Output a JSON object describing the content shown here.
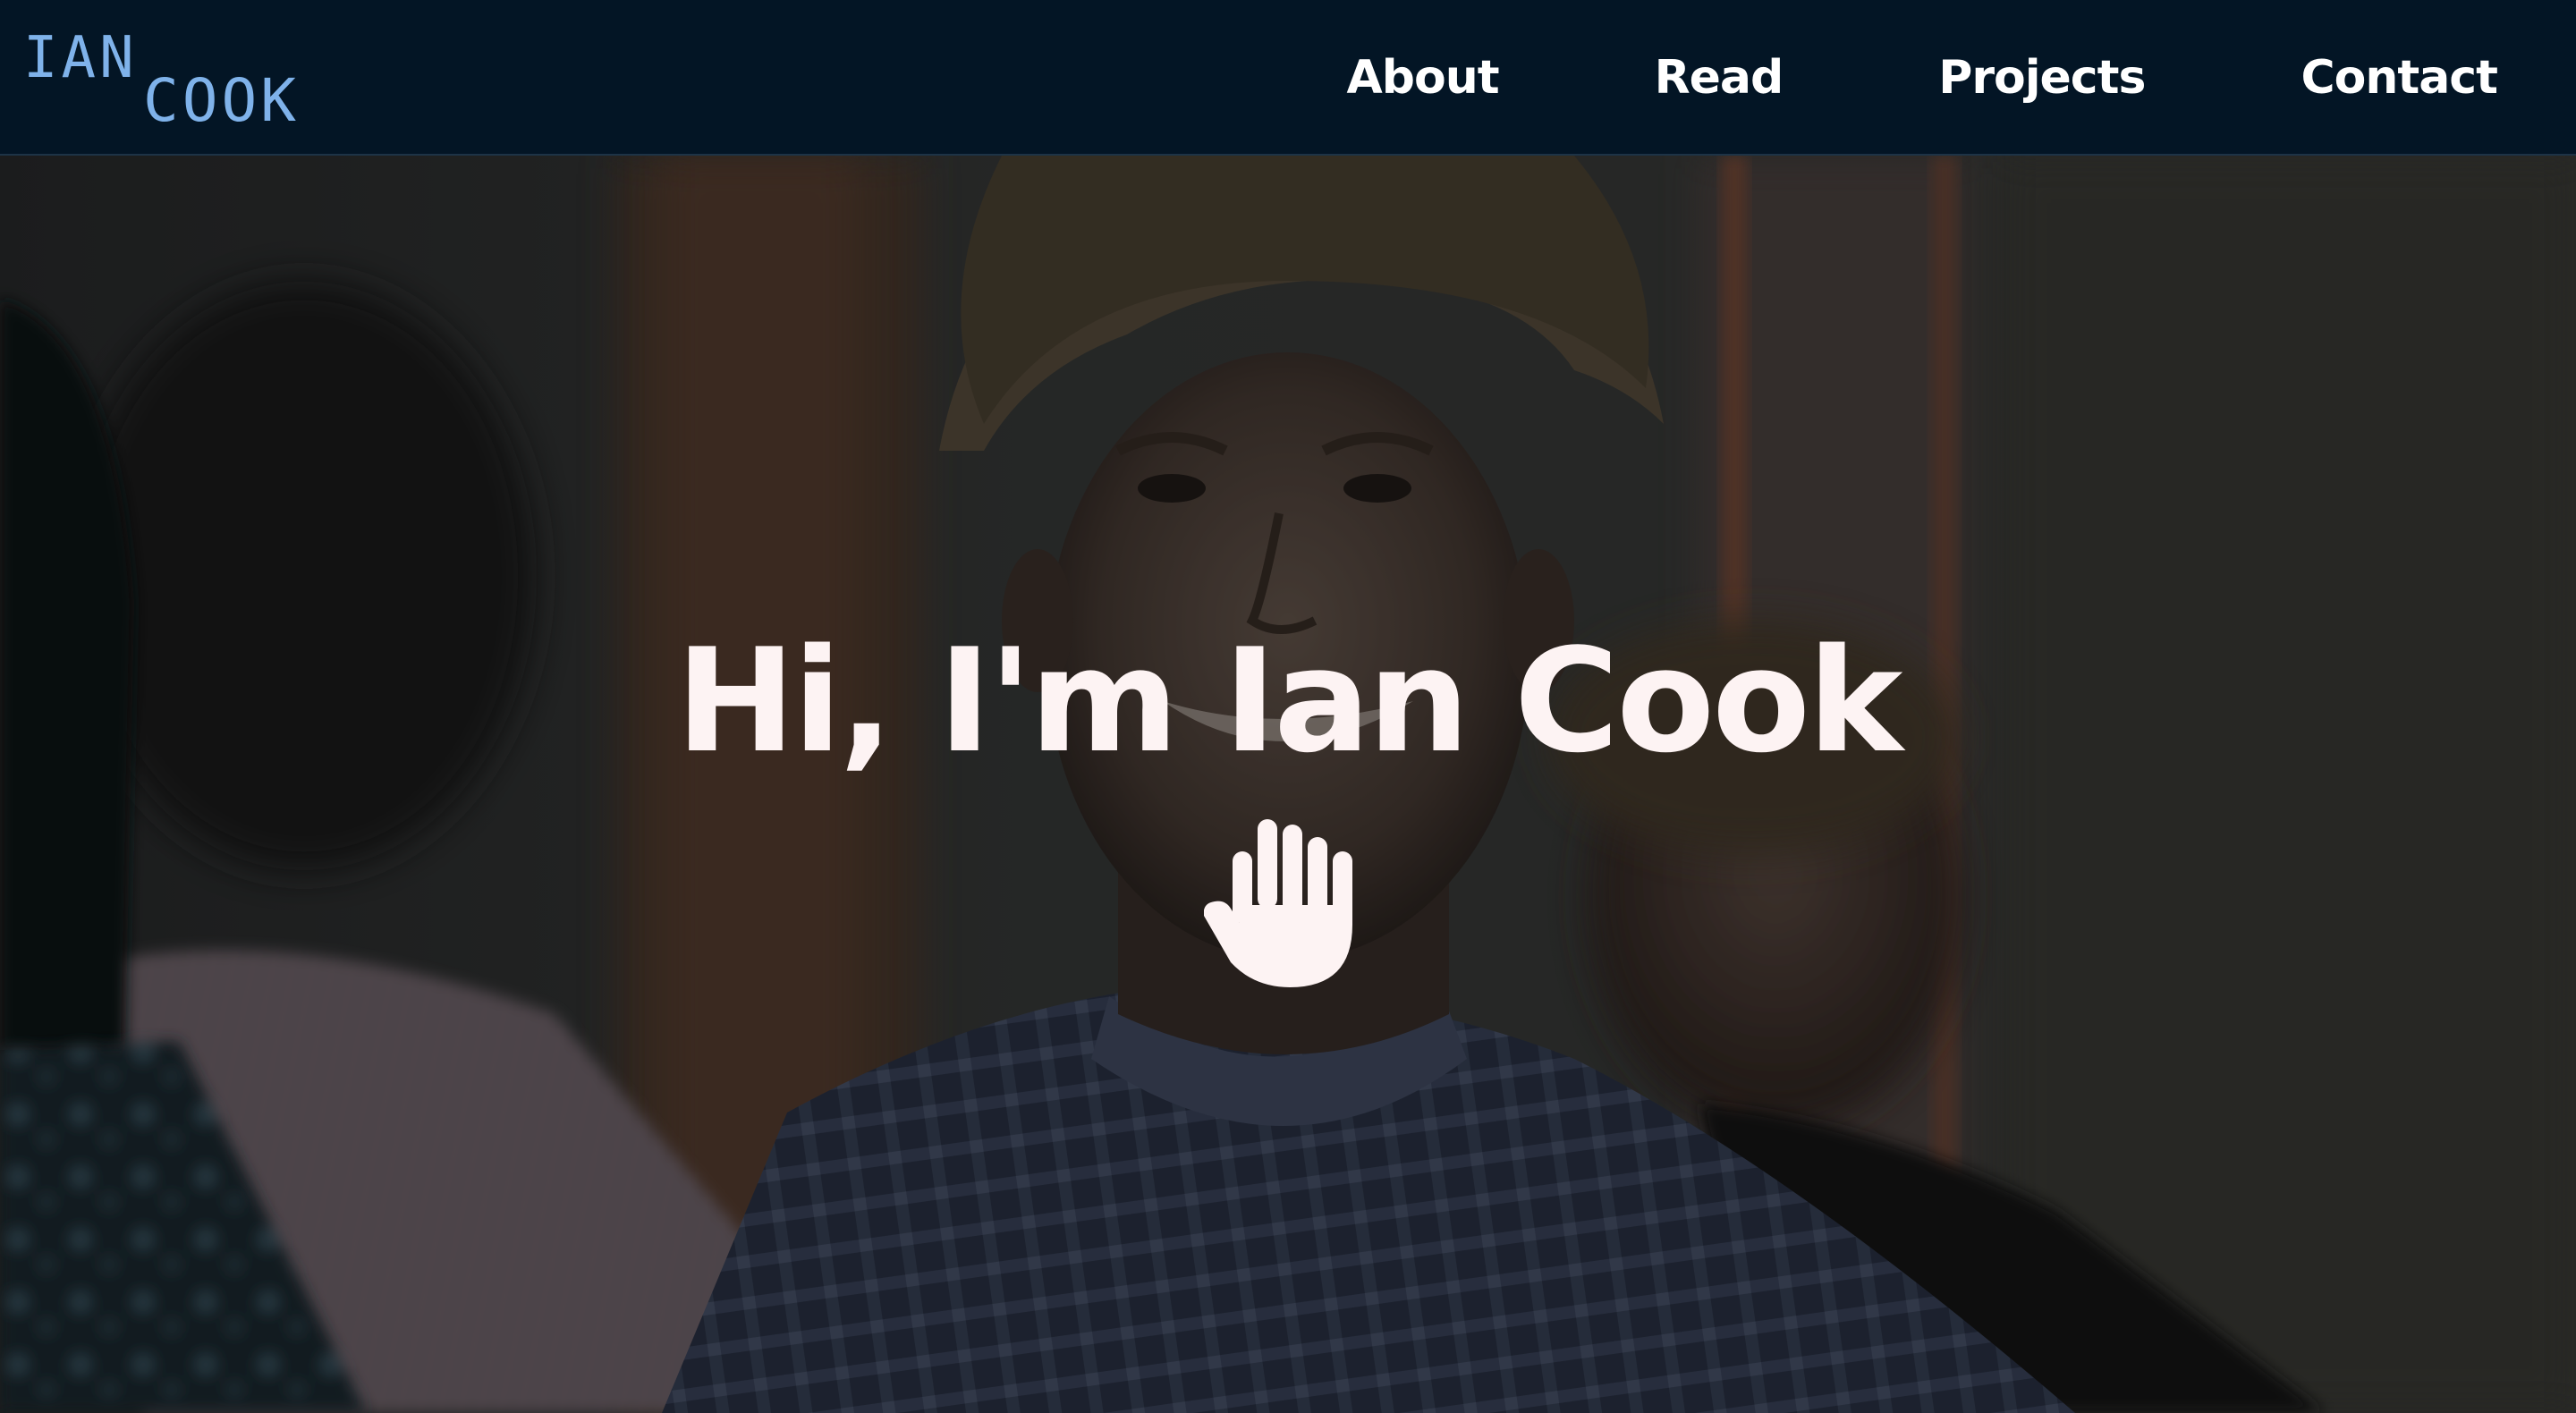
{
  "header": {
    "logo": {
      "first": "IAN",
      "last": "COOK"
    },
    "nav": [
      {
        "label": "About"
      },
      {
        "label": "Read"
      },
      {
        "label": "Projects"
      },
      {
        "label": "Contact"
      }
    ]
  },
  "hero": {
    "title": "Hi, I'm Ian Cook",
    "icon": "raised-hand-icon"
  },
  "colors": {
    "nav_background": "#031525",
    "logo": "#7fb2ea",
    "nav_text": "#ffffff",
    "hero_text": "#fdf3f3"
  }
}
